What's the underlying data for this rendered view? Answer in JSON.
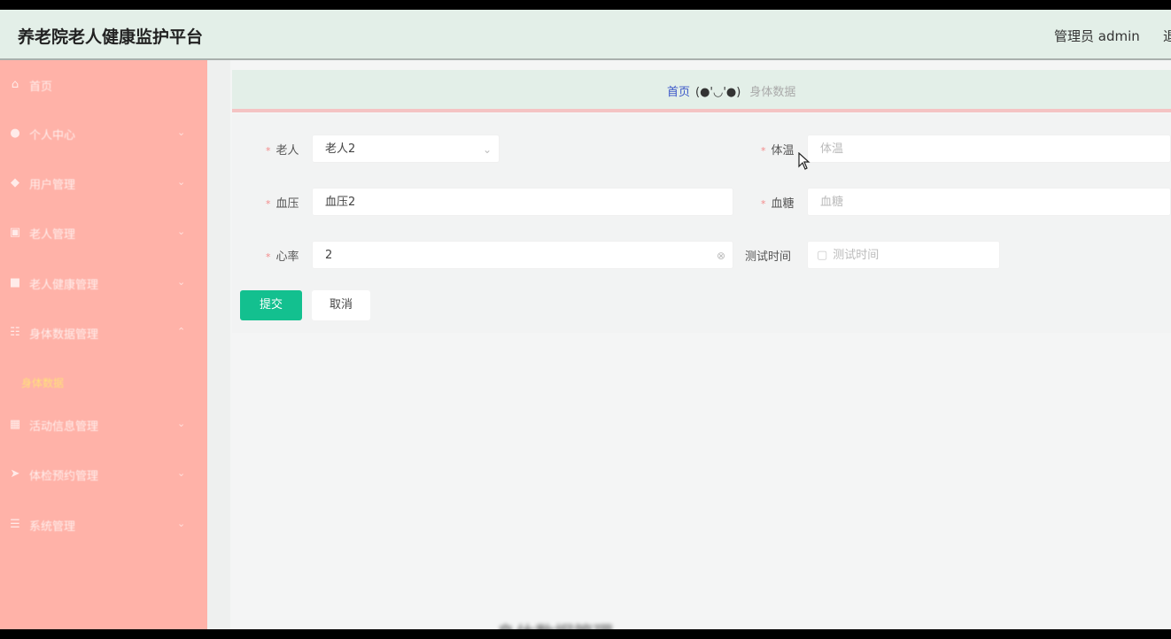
{
  "header": {
    "app_title": "养老院老人健康监护平台",
    "user_label": "管理员 admin",
    "logout_label": "退"
  },
  "sidebar": {
    "items": [
      {
        "label": "首页",
        "icon": "home-icon"
      },
      {
        "label": "个人中心",
        "icon": "user-icon"
      },
      {
        "label": "用户管理",
        "icon": "location-icon"
      },
      {
        "label": "老人管理",
        "icon": "card-icon"
      },
      {
        "label": "老人健康管理",
        "icon": "chat-icon"
      },
      {
        "label": "身体数据管理",
        "icon": "list-icon"
      },
      {
        "label": "活动信息管理",
        "icon": "grid-icon"
      },
      {
        "label": "体检预约管理",
        "icon": "send-icon"
      },
      {
        "label": "系统管理",
        "icon": "menu-icon"
      }
    ],
    "active_sub": "身体数据"
  },
  "breadcrumb": {
    "home": "首页",
    "emoticon": "(●'◡'●)",
    "current": "身体数据"
  },
  "form": {
    "elder": {
      "label": "老人",
      "value": "老人2"
    },
    "temperature": {
      "label": "体温",
      "placeholder": "体温"
    },
    "blood_pressure": {
      "label": "血压",
      "value": "血压2"
    },
    "blood_sugar": {
      "label": "血糖",
      "placeholder": "血糖"
    },
    "heart_rate": {
      "label": "心率",
      "value": "2"
    },
    "test_time": {
      "label": "测试时间",
      "placeholder": "测试时间"
    },
    "submit_label": "提交",
    "cancel_label": "取消"
  },
  "bottom_text": "身体数据管理"
}
